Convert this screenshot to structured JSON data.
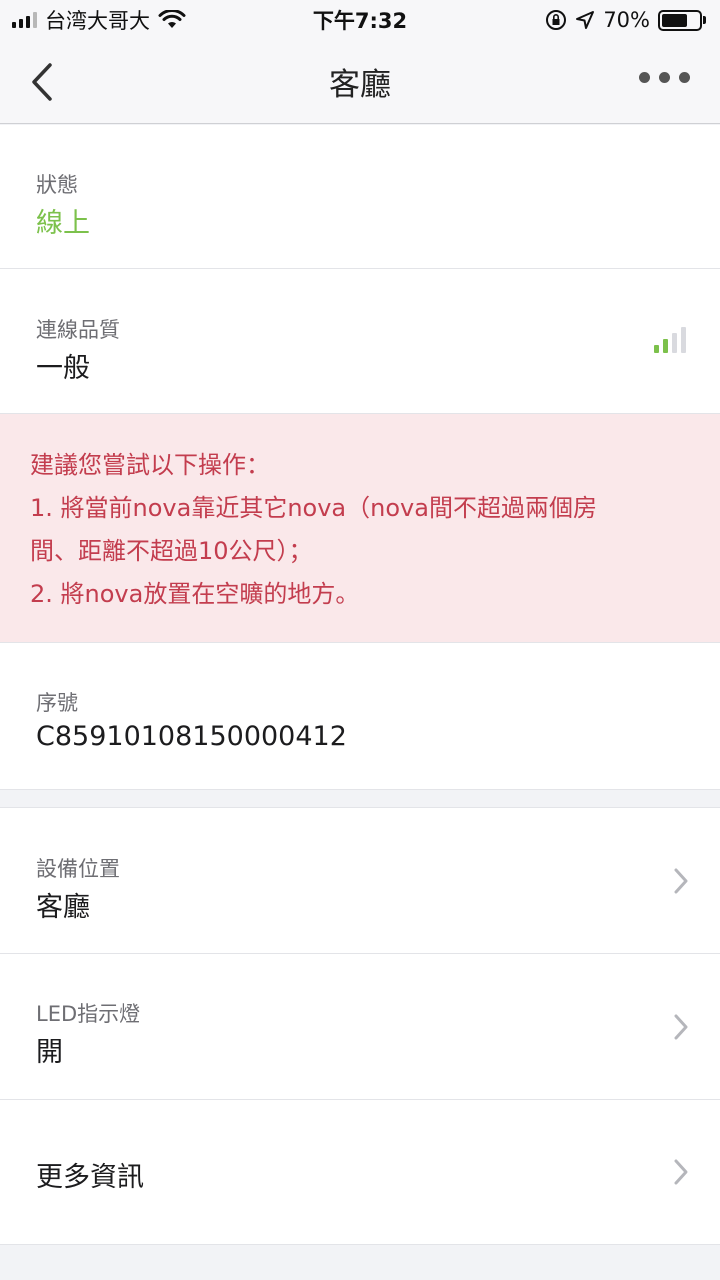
{
  "status_bar": {
    "carrier": "台湾大哥大",
    "time": "下午7:32",
    "battery": "70%",
    "battery_level": 0.7
  },
  "nav": {
    "title": "客廳",
    "back_icon": "chevron-left-icon",
    "more_icon": "more-dots-icon"
  },
  "status": {
    "label": "狀態",
    "value": "線上",
    "color": "#7cc14b"
  },
  "quality": {
    "label": "連線品質",
    "value": "一般",
    "signal_bars_active": 2,
    "signal_bars_total": 4,
    "active_color": "#7cc14b",
    "inactive_color": "#d9dadf"
  },
  "warning": {
    "lines": [
      "建議您嘗試以下操作：",
      "1. 將當前nova靠近其它nova（nova間不超過兩個房",
      "間、距離不超過10公尺）；",
      "2. 將nova放置在空曠的地方。"
    ],
    "color": "#c33d4e",
    "background": "#fae8ea"
  },
  "serial": {
    "label": "序號",
    "value": "C85910108150000412"
  },
  "location": {
    "label": "設備位置",
    "value": "客廳"
  },
  "led": {
    "label": "LED指示燈",
    "value": "開"
  },
  "more_info": {
    "label": "更多資訊"
  }
}
